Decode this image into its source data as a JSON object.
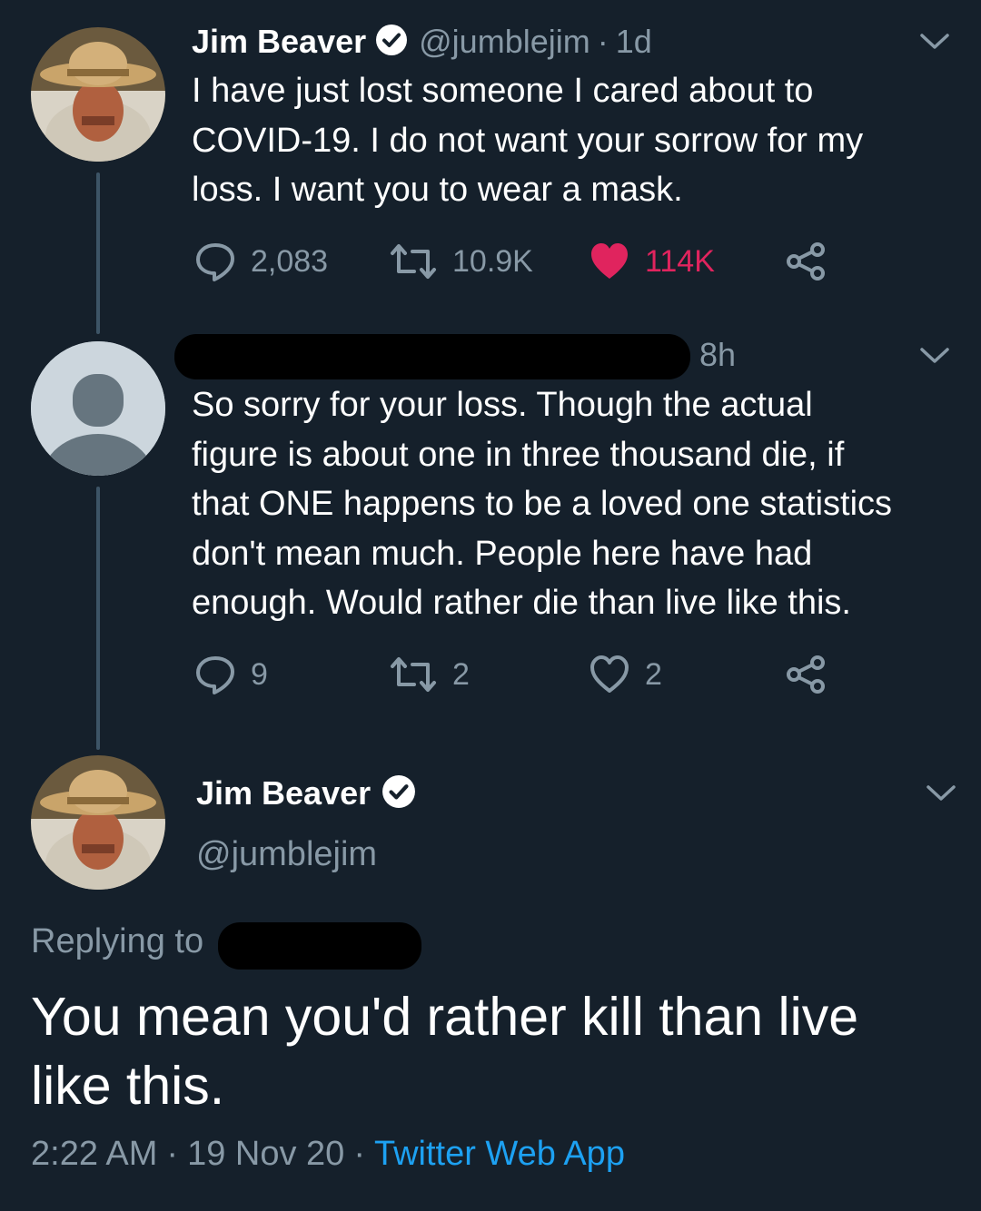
{
  "tweet1": {
    "display_name": "Jim Beaver",
    "handle": "@jumblejim",
    "separator": "·",
    "time": "1d",
    "text_lines": [
      "I have just lost someone I cared about to",
      "COVID-19.  I do not want your sorrow for my",
      "loss.  I want you to wear a mask."
    ],
    "replies": "2,083",
    "retweets": "10.9K",
    "likes": "114K"
  },
  "tweet2": {
    "time": "8h",
    "text_lines": [
      "So sorry for your loss. Though the actual",
      "figure is about one in three thousand die, if",
      "that ONE happens to be a loved one statistics",
      "don't mean much. People here have had",
      "enough. Would rather die than live like this."
    ],
    "replies": "9",
    "retweets": "2",
    "likes": "2"
  },
  "tweet3": {
    "display_name": "Jim Beaver",
    "handle": "@jumblejim",
    "replying_to_label": "Replying to",
    "text_lines": [
      "You mean you'd rather kill than live",
      "like this."
    ],
    "time": "2:22 AM",
    "date": "19 Nov 20",
    "separator": "·",
    "source": "Twitter Web App"
  },
  "colors": {
    "background": "#15202b",
    "accent": "#1da1f2",
    "like": "#e0245e",
    "muted": "#8899a6"
  },
  "icons": [
    "reply-icon",
    "retweet-icon",
    "heart-icon",
    "share-icon",
    "chevron-down-icon",
    "verified-badge-icon",
    "default-avatar-icon"
  ]
}
